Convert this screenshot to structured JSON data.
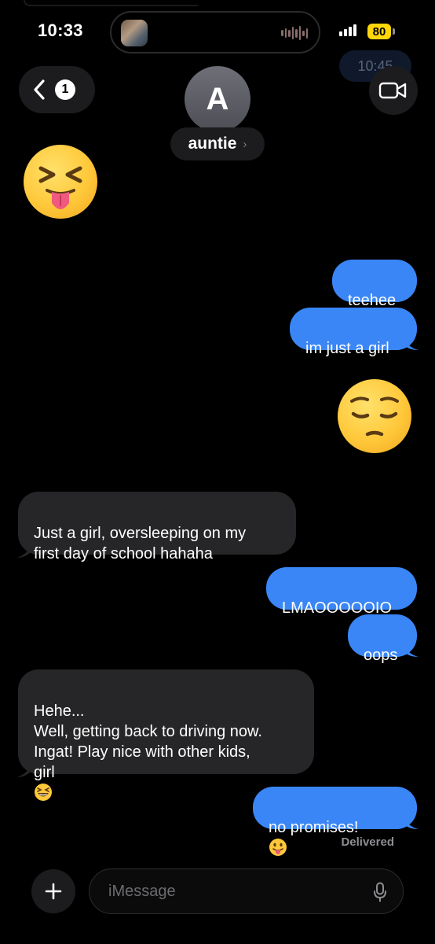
{
  "status_bar": {
    "time": "10:33",
    "battery": "80"
  },
  "ghost": {
    "time": "10:45"
  },
  "nav": {
    "unread_count": "1",
    "avatar_initial": "A",
    "contact_name": "auntie",
    "chevron": "›"
  },
  "messages": [
    {
      "from": "them",
      "type": "emoji",
      "emoji": "squinting-face-with-tongue"
    },
    {
      "from": "me",
      "text": "teehee"
    },
    {
      "from": "me",
      "text": "im just a girl"
    },
    {
      "from": "me",
      "type": "emoji",
      "emoji": "pensive-face"
    },
    {
      "from": "them",
      "text": "Just a girl, oversleeping on my\nfirst day of school hahaha"
    },
    {
      "from": "me",
      "text": "LMAOOOOOIO"
    },
    {
      "from": "me",
      "text": "oops"
    },
    {
      "from": "them",
      "text": "Hehe...\nWell, getting back to driving now.\nIngat! Play nice with other kids,\ngirl",
      "trailing_emoji": "grinning-squinting-face"
    },
    {
      "from": "me",
      "text": "no promises!",
      "trailing_emoji": "face-with-tongue"
    }
  ],
  "delivery_status": "Delivered",
  "composer": {
    "placeholder": "iMessage"
  },
  "colors": {
    "sent_bubble": "#3a86f7",
    "received_bubble": "#262628",
    "background": "#000000",
    "battery": "#ffd60a"
  }
}
